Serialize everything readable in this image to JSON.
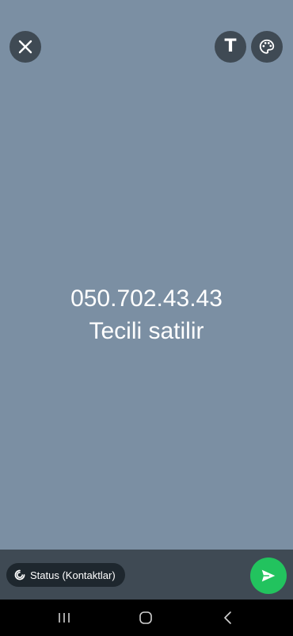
{
  "status": {
    "lines": [
      "050.702.43.43",
      "Tecili satilir"
    ],
    "background_color": "#7b8fa3"
  },
  "toolbar": {
    "close_icon": "close-icon",
    "text_tool_label": "T",
    "palette_icon": "palette-icon"
  },
  "footer": {
    "audience_label": "Status (Kontaktlar)",
    "audience_icon": "status-ring-icon",
    "send_icon": "send-icon",
    "send_color": "#22c35e"
  },
  "navigation": {
    "recents_icon": "recents-icon",
    "home_icon": "home-icon",
    "back_icon": "back-icon"
  }
}
